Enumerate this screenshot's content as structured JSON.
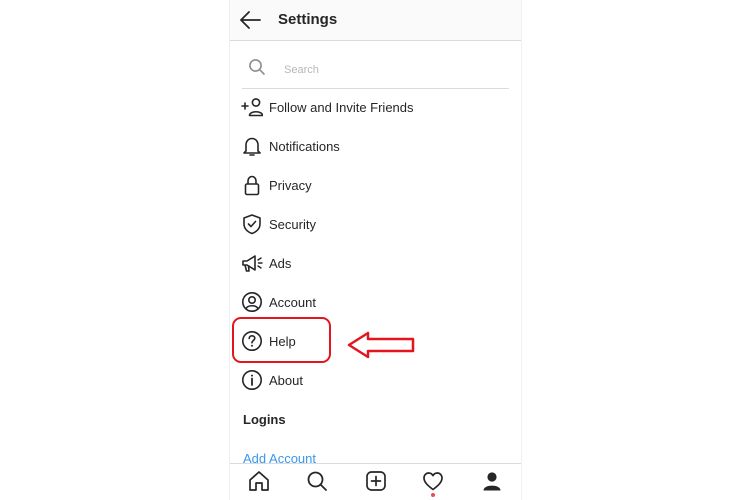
{
  "header": {
    "title": "Settings",
    "back_icon": "arrow-left-icon"
  },
  "search": {
    "placeholder": "Search",
    "value": "",
    "icon": "search-icon"
  },
  "menu": [
    {
      "label": "Follow and Invite Friends",
      "icon": "add-person-icon"
    },
    {
      "label": "Notifications",
      "icon": "bell-icon"
    },
    {
      "label": "Privacy",
      "icon": "lock-icon"
    },
    {
      "label": "Security",
      "icon": "shield-check-icon"
    },
    {
      "label": "Ads",
      "icon": "megaphone-icon"
    },
    {
      "label": "Account",
      "icon": "person-circle-icon"
    },
    {
      "label": "Help",
      "icon": "question-circle-icon"
    },
    {
      "label": "About",
      "icon": "info-circle-icon"
    }
  ],
  "logins": {
    "title": "Logins",
    "add_account": "Add Account"
  },
  "bottom_nav": {
    "items": [
      "home-icon",
      "search-icon",
      "plus-square-icon",
      "heart-icon",
      "profile-icon"
    ],
    "active": "profile-icon",
    "activity_indicator": true
  },
  "annotation": {
    "highlighted_item": "Help",
    "color": "#e3151e"
  },
  "colors": {
    "text": "#262626",
    "link": "#3897f0",
    "divider": "#dbdbdb",
    "header_bg": "#fafafa",
    "annotation": "#e3151e",
    "notification_dot": "#ed4956"
  }
}
